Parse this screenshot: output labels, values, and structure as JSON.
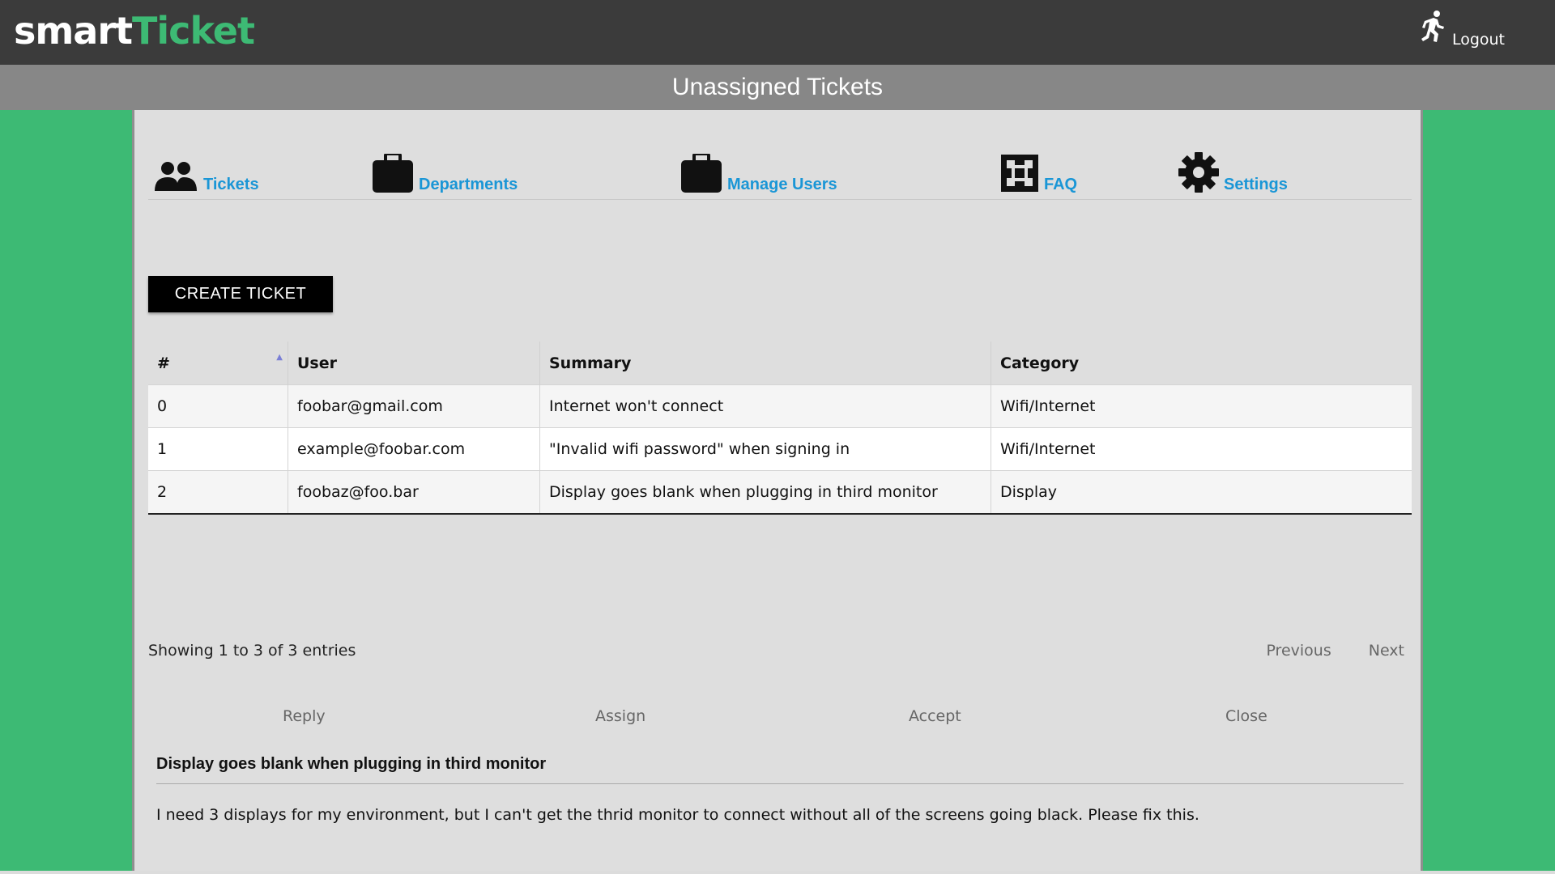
{
  "app": {
    "logo_part1": "smart",
    "logo_part2": "Ticket",
    "logout_label": "Logout",
    "page_title": "Unassigned Tickets"
  },
  "colors": {
    "brand_green": "#3dba74",
    "topbar": "#3b3b3b",
    "title_band": "#878787",
    "link_blue": "#1a96d6"
  },
  "nav": [
    {
      "label": "Tickets",
      "icon": "users-icon"
    },
    {
      "label": "Departments",
      "icon": "briefcase-icon"
    },
    {
      "label": "Manage Users",
      "icon": "briefcase-icon"
    },
    {
      "label": "FAQ",
      "icon": "puzzle-icon"
    },
    {
      "label": "Settings",
      "icon": "gear-icon"
    }
  ],
  "create_ticket_label": "CREATE TICKET",
  "table": {
    "headers": [
      "#",
      "User",
      "Summary",
      "Category"
    ],
    "sort_indicator": "▲",
    "rows": [
      {
        "num": "0",
        "user": "foobar@gmail.com",
        "summary": "Internet won't connect",
        "category": "Wifi/Internet"
      },
      {
        "num": "1",
        "user": "example@foobar.com",
        "summary": "\"Invalid wifi password\" when signing in",
        "category": "Wifi/Internet"
      },
      {
        "num": "2",
        "user": "foobaz@foo.bar",
        "summary": "Display goes blank when plugging in third monitor",
        "category": "Display"
      }
    ],
    "info": "Showing 1 to 3 of 3 entries",
    "previous_label": "Previous",
    "next_label": "Next"
  },
  "actions": {
    "reply": "Reply",
    "assign": "Assign",
    "accept": "Accept",
    "close": "Close"
  },
  "detail": {
    "title": "Display goes blank when plugging in third monitor",
    "body": "I need 3 displays for my environment, but I can't get the thrid monitor to connect without all of the screens going black. Please fix this."
  }
}
